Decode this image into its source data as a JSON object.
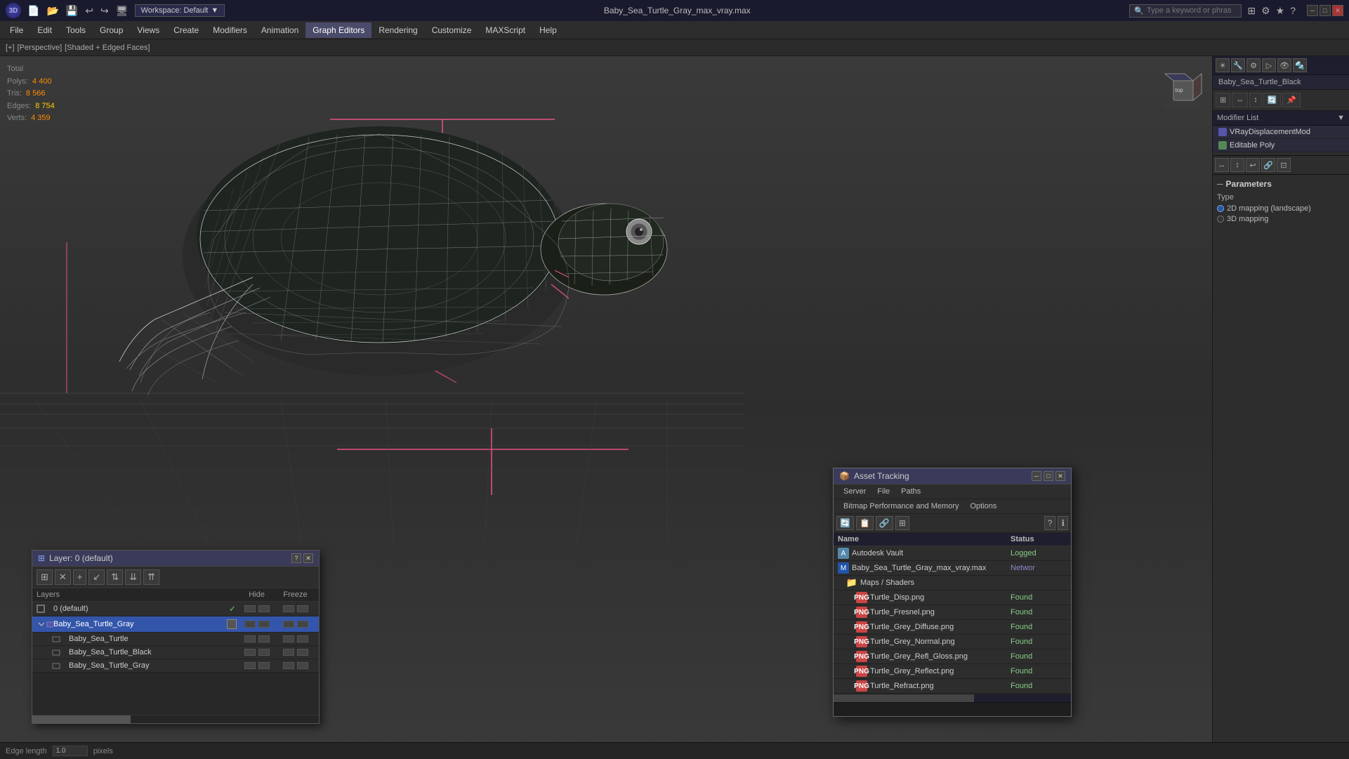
{
  "app": {
    "title": "Baby_Sea_Turtle_Gray_max_vray.max",
    "logo_text": "3D"
  },
  "titlebar": {
    "workspace_label": "Workspace: Default",
    "search_placeholder": "Type a keyword or phrase"
  },
  "menubar": {
    "items": [
      {
        "id": "file",
        "label": "File"
      },
      {
        "id": "edit",
        "label": "Edit"
      },
      {
        "id": "tools",
        "label": "Tools"
      },
      {
        "id": "group",
        "label": "Group"
      },
      {
        "id": "views",
        "label": "Views"
      },
      {
        "id": "create",
        "label": "Create"
      },
      {
        "id": "modifiers",
        "label": "Modifiers"
      },
      {
        "id": "animation",
        "label": "Animation"
      },
      {
        "id": "graph-editors",
        "label": "Graph Editors"
      },
      {
        "id": "rendering",
        "label": "Rendering"
      },
      {
        "id": "customize",
        "label": "Customize"
      },
      {
        "id": "maxscript",
        "label": "MAXScript"
      },
      {
        "id": "help",
        "label": "Help"
      }
    ]
  },
  "viewport": {
    "label": "[+] [Perspective] [Shaded + Edged Faces]",
    "stats": {
      "total_label": "Total",
      "polys_label": "Polys:",
      "polys_value": "4 400",
      "tris_label": "Tris:",
      "tris_value": "8 566",
      "edges_label": "Edges:",
      "edges_value": "8 754",
      "verts_label": "Verts:",
      "verts_value": "4 359"
    }
  },
  "right_panel": {
    "object_name": "Baby_Sea_Turtle_Black",
    "modifier_list_label": "Modifier List",
    "modifiers": [
      {
        "name": "VRayDisplacementMod",
        "type": "vray"
      },
      {
        "name": "Editable Poly",
        "type": "poly"
      }
    ],
    "params_title": "Parameters",
    "type_label": "Type",
    "type_options": [
      {
        "label": "2D mapping (landscape)",
        "selected": true
      },
      {
        "label": "3D mapping",
        "selected": false
      }
    ]
  },
  "layer_dialog": {
    "title": "Layer: 0 (default)",
    "help_char": "?",
    "toolbar": [
      "⊞",
      "✕",
      "+",
      "↙",
      "⇅",
      "⇊",
      "⇈"
    ],
    "columns": {
      "name": "Layers",
      "hide": "Hide",
      "freeze": "Freeze"
    },
    "layers": [
      {
        "name": "0 (default)",
        "indent": 0,
        "selected": false,
        "checked": true,
        "type": "default"
      },
      {
        "name": "Baby_Sea_Turtle_Gray",
        "indent": 1,
        "selected": true,
        "checked": false,
        "type": "layer"
      },
      {
        "name": "Baby_Sea_Turtle",
        "indent": 2,
        "selected": false,
        "checked": false,
        "type": "sub"
      },
      {
        "name": "Baby_Sea_Turtle_Black",
        "indent": 2,
        "selected": false,
        "checked": false,
        "type": "sub"
      },
      {
        "name": "Baby_Sea_Turtle_Gray",
        "indent": 2,
        "selected": false,
        "checked": false,
        "type": "sub"
      }
    ]
  },
  "asset_dialog": {
    "title": "Asset Tracking",
    "menu": [
      "Server",
      "File",
      "Paths"
    ],
    "submenu": [
      "Bitmap Performance and Memory",
      "Options"
    ],
    "toolbar_icons": [
      "📂",
      "📋",
      "🔗",
      "⊞",
      "🗑"
    ],
    "columns": {
      "name": "Name",
      "status": "Status"
    },
    "assets": [
      {
        "name": "Autodesk Vault",
        "indent": 0,
        "type": "vault",
        "status": "Logged"
      },
      {
        "name": "Baby_Sea_Turtle_Gray_max_vray.max",
        "indent": 0,
        "type": "max",
        "status": "Networ"
      },
      {
        "name": "Maps / Shaders",
        "indent": 1,
        "type": "folder",
        "status": ""
      },
      {
        "name": "Turtle_Disp.png",
        "indent": 2,
        "type": "png",
        "status": "Found"
      },
      {
        "name": "Turtle_Fresnel.png",
        "indent": 2,
        "type": "png",
        "status": "Found"
      },
      {
        "name": "Turtle_Grey_Diffuse.png",
        "indent": 2,
        "type": "png",
        "status": "Found"
      },
      {
        "name": "Turtle_Grey_Normal.png",
        "indent": 2,
        "type": "png",
        "status": "Found"
      },
      {
        "name": "Turtle_Grey_Refl_Gloss.png",
        "indent": 2,
        "type": "png",
        "status": "Found"
      },
      {
        "name": "Turtle_Grey_Reflect.png",
        "indent": 2,
        "type": "png",
        "status": "Found"
      },
      {
        "name": "Turtle_Refract.png",
        "indent": 2,
        "type": "png",
        "status": "Found"
      }
    ]
  },
  "bottom_bar": {
    "edge_length_label": "Edge length",
    "edge_length_value": "1.0",
    "pixels_label": "pixels"
  }
}
